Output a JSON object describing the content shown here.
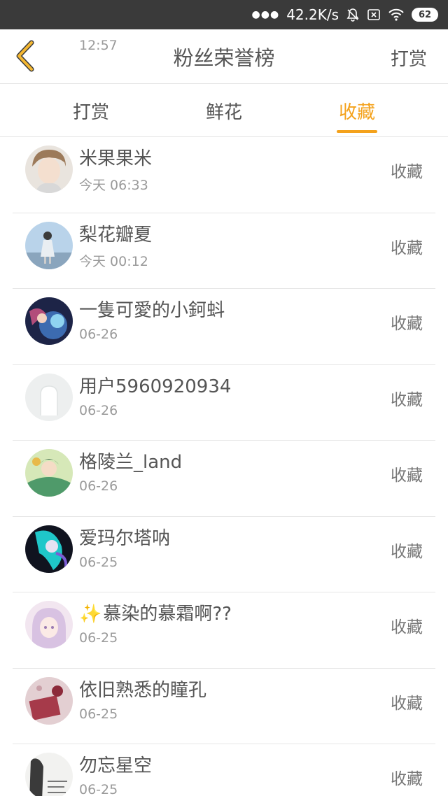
{
  "status": {
    "time": "12:57",
    "speed": "42.2K/s",
    "battery": "62"
  },
  "header": {
    "title": "粉丝荣誉榜",
    "action": "打赏"
  },
  "tabs": [
    {
      "label": "打赏"
    },
    {
      "label": "鲜花"
    },
    {
      "label": "收藏"
    }
  ],
  "colors": {
    "accent": "#f4a21c",
    "statusbar": "#3a3a3a"
  },
  "rows": [
    {
      "name": "米果果米",
      "time": "今天 06:33",
      "action": "收藏",
      "avatar": "avatar-photo-boy"
    },
    {
      "name": "梨花瓣夏",
      "time": "今天 00:12",
      "action": "收藏",
      "avatar": "avatar-photo-girl"
    },
    {
      "name": "一隻可愛的小鈳蚪",
      "time": "06-26",
      "action": "收藏",
      "avatar": "avatar-anime-dark"
    },
    {
      "name": "用户5960920934",
      "time": "06-26",
      "action": "收藏",
      "avatar": "avatar-default"
    },
    {
      "name": "格陵兰_land",
      "time": "06-26",
      "action": "收藏",
      "avatar": "avatar-anime-green"
    },
    {
      "name": "爱玛尔塔呐",
      "time": "06-25",
      "action": "收藏",
      "avatar": "avatar-anime-cyan"
    },
    {
      "name": "慕染的慕霜啊??",
      "time": "06-25",
      "action": "收藏",
      "avatar": "avatar-anime-pink",
      "prefix_icon": "sparkle-icon"
    },
    {
      "name": "依旧熟悉的瞳孔",
      "time": "06-25",
      "action": "收藏",
      "avatar": "avatar-photo-red"
    },
    {
      "name": "勿忘星空",
      "time": "06-25",
      "action": "收藏",
      "avatar": "avatar-photo-text"
    }
  ]
}
